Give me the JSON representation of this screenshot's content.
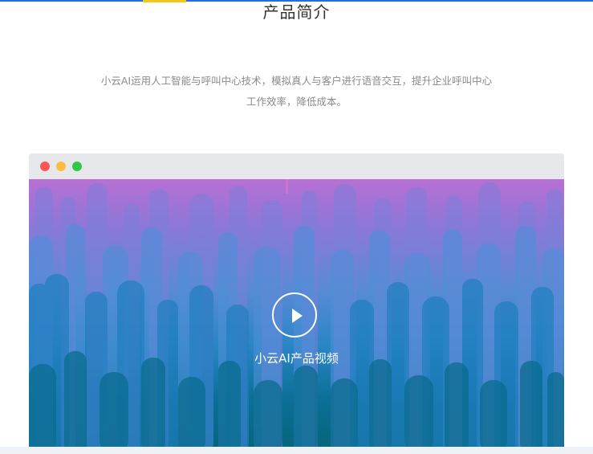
{
  "section": {
    "title": "产品简介",
    "intro_line1": "小云AI运用人工智能与呼叫中心技术，模拟真人与客户进行语音交互，提升企业呼叫中心",
    "intro_line2": "工作效率，降低成本。"
  },
  "video": {
    "caption": "小云AI产品视频",
    "play_icon": "play-icon"
  },
  "colors": {
    "accent_line": "#1f6fe0",
    "tab_indicator": "#f5c518",
    "window_dot_red": "#fc5753",
    "window_dot_yellow": "#fdbc40",
    "window_dot_green": "#33c748"
  }
}
